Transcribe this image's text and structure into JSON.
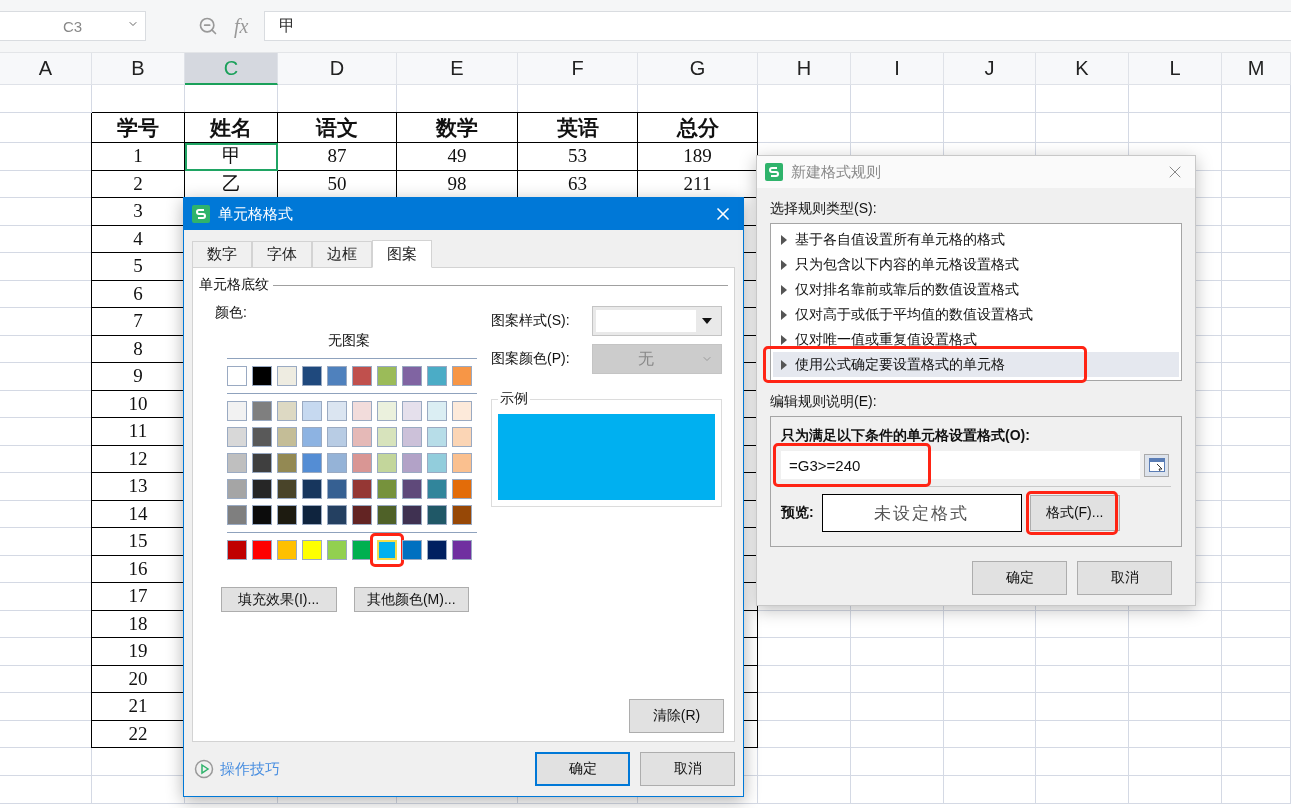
{
  "formula_bar": {
    "name_box": "C3",
    "function_label": "fx",
    "formula": "甲"
  },
  "columns": [
    {
      "label": "A",
      "selected": false
    },
    {
      "label": "B",
      "selected": false
    },
    {
      "label": "C",
      "selected": true
    },
    {
      "label": "D",
      "selected": false
    },
    {
      "label": "E",
      "selected": false
    },
    {
      "label": "F",
      "selected": false
    },
    {
      "label": "G",
      "selected": false
    },
    {
      "label": "H",
      "selected": false
    },
    {
      "label": "I",
      "selected": false
    },
    {
      "label": "J",
      "selected": false
    },
    {
      "label": "K",
      "selected": false
    },
    {
      "label": "L",
      "selected": false
    },
    {
      "label": "M",
      "selected": false
    }
  ],
  "table": {
    "headers": [
      "学号",
      "姓名",
      "语文",
      "数学",
      "英语",
      "总分"
    ],
    "rows": [
      {
        "cells": [
          {
            "text": "1",
            "selected": false
          },
          {
            "text": "甲",
            "selected": true
          },
          {
            "text": "87",
            "selected": false
          },
          {
            "text": "49",
            "selected": false
          },
          {
            "text": "53",
            "selected": false
          },
          {
            "text": "189",
            "selected": false
          }
        ]
      },
      {
        "cells": [
          {
            "text": "2",
            "selected": false
          },
          {
            "text": "乙",
            "selected": false
          },
          {
            "text": "50",
            "selected": false
          },
          {
            "text": "98",
            "selected": false
          },
          {
            "text": "63",
            "selected": false
          },
          {
            "text": "211",
            "selected": false
          }
        ]
      },
      {
        "cells": [
          {
            "text": "3",
            "selected": false
          }
        ]
      },
      {
        "cells": [
          {
            "text": "4",
            "selected": false
          }
        ]
      },
      {
        "cells": [
          {
            "text": "5",
            "selected": false
          }
        ]
      },
      {
        "cells": [
          {
            "text": "6",
            "selected": false
          }
        ]
      },
      {
        "cells": [
          {
            "text": "7",
            "selected": false
          }
        ]
      },
      {
        "cells": [
          {
            "text": "8",
            "selected": false
          }
        ]
      },
      {
        "cells": [
          {
            "text": "9",
            "selected": false
          }
        ]
      },
      {
        "cells": [
          {
            "text": "10",
            "selected": false
          }
        ]
      },
      {
        "cells": [
          {
            "text": "11",
            "selected": false
          }
        ]
      },
      {
        "cells": [
          {
            "text": "12",
            "selected": false
          }
        ]
      },
      {
        "cells": [
          {
            "text": "13",
            "selected": false
          }
        ]
      },
      {
        "cells": [
          {
            "text": "14",
            "selected": false
          }
        ]
      },
      {
        "cells": [
          {
            "text": "15",
            "selected": false
          }
        ]
      },
      {
        "cells": [
          {
            "text": "16",
            "selected": false
          }
        ]
      },
      {
        "cells": [
          {
            "text": "17",
            "selected": false
          }
        ]
      },
      {
        "cells": [
          {
            "text": "18",
            "selected": false
          }
        ]
      },
      {
        "cells": [
          {
            "text": "19",
            "selected": false
          }
        ]
      },
      {
        "cells": [
          {
            "text": "20",
            "selected": false
          }
        ]
      },
      {
        "cells": [
          {
            "text": "21",
            "selected": false
          }
        ]
      },
      {
        "cells": [
          {
            "text": "22",
            "selected": false
          }
        ]
      }
    ]
  },
  "format_cells_dialog": {
    "title": "单元格格式",
    "tabs": [
      {
        "label": "数字",
        "selected": false
      },
      {
        "label": "字体",
        "selected": false
      },
      {
        "label": "边框",
        "selected": false
      },
      {
        "label": "图案",
        "selected": true
      }
    ],
    "section_title": "单元格底纹",
    "color_label": "颜色:",
    "no_pattern": "无图案",
    "palette": {
      "theme": [
        {
          "color": "#ffffff",
          "selected": false,
          "annotated": false
        },
        {
          "color": "#000000",
          "selected": false,
          "annotated": false
        },
        {
          "color": "#eeece1",
          "selected": false,
          "annotated": false
        },
        {
          "color": "#1f497d",
          "selected": false,
          "annotated": false
        },
        {
          "color": "#4f81bd",
          "selected": false,
          "annotated": false
        },
        {
          "color": "#c0504d",
          "selected": false,
          "annotated": false
        },
        {
          "color": "#9bbb59",
          "selected": false,
          "annotated": false
        },
        {
          "color": "#8064a2",
          "selected": false,
          "annotated": false
        },
        {
          "color": "#4bacc6",
          "selected": false,
          "annotated": false
        },
        {
          "color": "#f79646",
          "selected": false,
          "annotated": false
        }
      ],
      "shades": [
        {
          "color": "#f2f2f2",
          "selected": false,
          "annotated": false
        },
        {
          "color": "#7f7f7f",
          "selected": false,
          "annotated": false
        },
        {
          "color": "#ddd9c3",
          "selected": false,
          "annotated": false
        },
        {
          "color": "#c6d9f0",
          "selected": false,
          "annotated": false
        },
        {
          "color": "#dbe5f1",
          "selected": false,
          "annotated": false
        },
        {
          "color": "#f2dcdb",
          "selected": false,
          "annotated": false
        },
        {
          "color": "#ebf1dd",
          "selected": false,
          "annotated": false
        },
        {
          "color": "#e5e0ec",
          "selected": false,
          "annotated": false
        },
        {
          "color": "#dbeef3",
          "selected": false,
          "annotated": false
        },
        {
          "color": "#fdeada",
          "selected": false,
          "annotated": false
        },
        {
          "color": "#d8d8d8",
          "selected": false,
          "annotated": false
        },
        {
          "color": "#595959",
          "selected": false,
          "annotated": false
        },
        {
          "color": "#c4bd97",
          "selected": false,
          "annotated": false
        },
        {
          "color": "#8db3e2",
          "selected": false,
          "annotated": false
        },
        {
          "color": "#b8cce4",
          "selected": false,
          "annotated": false
        },
        {
          "color": "#e5b9b7",
          "selected": false,
          "annotated": false
        },
        {
          "color": "#d7e3bc",
          "selected": false,
          "annotated": false
        },
        {
          "color": "#ccc1d9",
          "selected": false,
          "annotated": false
        },
        {
          "color": "#b7dde8",
          "selected": false,
          "annotated": false
        },
        {
          "color": "#fbd5b5",
          "selected": false,
          "annotated": false
        },
        {
          "color": "#bfbfbf",
          "selected": false,
          "annotated": false
        },
        {
          "color": "#3f3f3f",
          "selected": false,
          "annotated": false
        },
        {
          "color": "#938953",
          "selected": false,
          "annotated": false
        },
        {
          "color": "#548dd4",
          "selected": false,
          "annotated": false
        },
        {
          "color": "#95b3d7",
          "selected": false,
          "annotated": false
        },
        {
          "color": "#d99694",
          "selected": false,
          "annotated": false
        },
        {
          "color": "#c3d69b",
          "selected": false,
          "annotated": false
        },
        {
          "color": "#b2a2c7",
          "selected": false,
          "annotated": false
        },
        {
          "color": "#92cddc",
          "selected": false,
          "annotated": false
        },
        {
          "color": "#fac08f",
          "selected": false,
          "annotated": false
        },
        {
          "color": "#a5a5a5",
          "selected": false,
          "annotated": false
        },
        {
          "color": "#262626",
          "selected": false,
          "annotated": false
        },
        {
          "color": "#494429",
          "selected": false,
          "annotated": false
        },
        {
          "color": "#17365d",
          "selected": false,
          "annotated": false
        },
        {
          "color": "#366092",
          "selected": false,
          "annotated": false
        },
        {
          "color": "#953734",
          "selected": false,
          "annotated": false
        },
        {
          "color": "#76923c",
          "selected": false,
          "annotated": false
        },
        {
          "color": "#5f497a",
          "selected": false,
          "annotated": false
        },
        {
          "color": "#31859b",
          "selected": false,
          "annotated": false
        },
        {
          "color": "#e36c09",
          "selected": false,
          "annotated": false
        },
        {
          "color": "#7f7f7f",
          "selected": false,
          "annotated": false
        },
        {
          "color": "#0c0c0c",
          "selected": false,
          "annotated": false
        },
        {
          "color": "#1d1b10",
          "selected": false,
          "annotated": false
        },
        {
          "color": "#0f243e",
          "selected": false,
          "annotated": false
        },
        {
          "color": "#244061",
          "selected": false,
          "annotated": false
        },
        {
          "color": "#632423",
          "selected": false,
          "annotated": false
        },
        {
          "color": "#4f6128",
          "selected": false,
          "annotated": false
        },
        {
          "color": "#3f3151",
          "selected": false,
          "annotated": false
        },
        {
          "color": "#205867",
          "selected": false,
          "annotated": false
        },
        {
          "color": "#974806",
          "selected": false,
          "annotated": false
        }
      ],
      "standard": [
        {
          "color": "#c00000",
          "selected": false,
          "annotated": false
        },
        {
          "color": "#ff0000",
          "selected": false,
          "annotated": false
        },
        {
          "color": "#ffc000",
          "selected": false,
          "annotated": false
        },
        {
          "color": "#ffff00",
          "selected": false,
          "annotated": false
        },
        {
          "color": "#92d050",
          "selected": false,
          "annotated": false
        },
        {
          "color": "#00b050",
          "selected": false,
          "annotated": false
        },
        {
          "color": "#00b0f0",
          "selected": true,
          "annotated": true
        },
        {
          "color": "#0070c0",
          "selected": false,
          "annotated": false
        },
        {
          "color": "#002060",
          "selected": false,
          "annotated": false
        },
        {
          "color": "#7030a0",
          "selected": false,
          "annotated": false
        }
      ]
    },
    "fill_effects_button": "填充效果(I)...",
    "more_colors_button": "其他颜色(M)...",
    "pattern_style": {
      "label": "图案样式(S):"
    },
    "pattern_color": {
      "label": "图案颜色(P):",
      "value": "无",
      "disabled": true
    },
    "sample_label": "示例",
    "clear_button": "清除(R)",
    "tips_link": "操作技巧",
    "buttons": [
      {
        "label": "确定",
        "default": true
      },
      {
        "label": "取消",
        "default": false
      }
    ]
  },
  "new_rule_dialog": {
    "title": "新建格式规则",
    "rule_type_label": "选择规则类型(S):",
    "rule_types": [
      {
        "label": "基于各自值设置所有单元格的格式",
        "selected": false,
        "annotated": false
      },
      {
        "label": "只为包含以下内容的单元格设置格式",
        "selected": false,
        "annotated": false
      },
      {
        "label": "仅对排名靠前或靠后的数值设置格式",
        "selected": false,
        "annotated": false
      },
      {
        "label": "仅对高于或低于平均值的数值设置格式",
        "selected": false,
        "annotated": false
      },
      {
        "label": "仅对唯一值或重复值设置格式",
        "selected": false,
        "annotated": false
      },
      {
        "label": "使用公式确定要设置格式的单元格",
        "selected": true,
        "annotated": true
      }
    ],
    "edit_label": "编辑规则说明(E):",
    "condition_label": "只为满足以下条件的单元格设置格式(O):",
    "formula": {
      "value": "=G3>=240",
      "annotated": true
    },
    "preview_label": "预览:",
    "preview_text": "未设定格式",
    "format_button": {
      "label": "格式(F)...",
      "annotated": true
    },
    "buttons": [
      {
        "label": "确定"
      },
      {
        "label": "取消"
      }
    ]
  }
}
